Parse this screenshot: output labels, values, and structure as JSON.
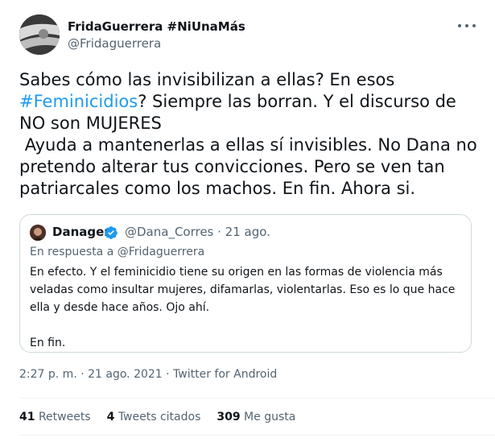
{
  "author": {
    "name": "FridaGuerrera #NiUnaMás",
    "handle": "@Fridaguerrera"
  },
  "tweet": {
    "text_before": "Sabes cómo las invisibilizan a ellas? En esos ",
    "hashtag": "#Feminicidios",
    "text_after": "? Siempre las borran. Y el discurso de NO son MUJERES\n Ayuda a mantenerlas a ellas sí invisibles. No Dana no pretendo alterar tus convicciones. Pero se ven tan patriarcales como los machos. En fin. Ahora si."
  },
  "quote": {
    "name": "Danager",
    "meta": "@Dana_Corres · 21 ago.",
    "reply_to": "En respuesta a @Fridaguerrera",
    "text": "En efecto. Y el feminicidio tiene su origen en las formas de violencia más veladas como insultar mujeres, difamarlas, violentarlas. Eso es lo que hace ella y desde hace años. Ojo ahí.\n\nEn fin."
  },
  "timestamp": "2:27 p. m. · 21 ago. 2021 · Twitter for Android",
  "stats": {
    "retweets_count": "41",
    "retweets_label": "Retweets",
    "quotes_count": "4",
    "quotes_label": "Tweets citados",
    "likes_count": "309",
    "likes_label": "Me gusta"
  },
  "colors": {
    "link": "#1d9bf0",
    "verified": "#1d9bf0",
    "secondary_text": "#536471"
  }
}
